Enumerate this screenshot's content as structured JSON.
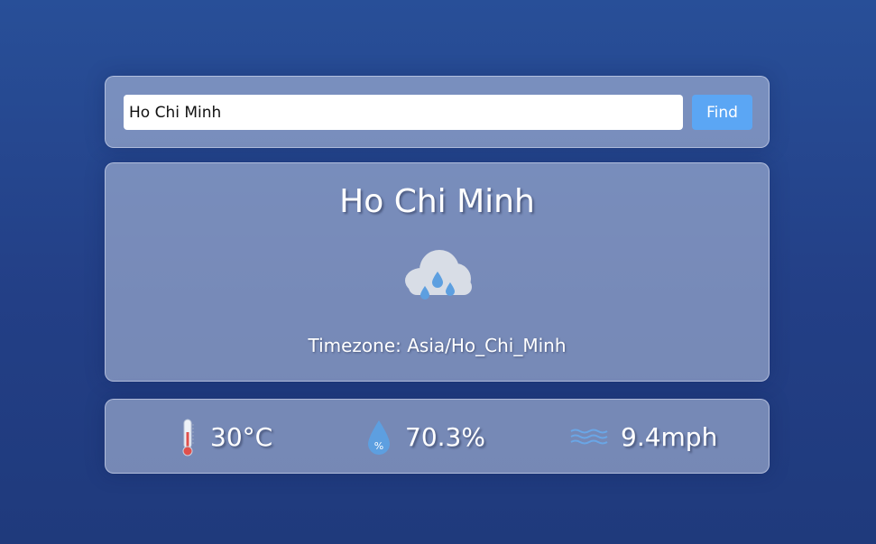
{
  "search": {
    "value": "Ho Chi Minh",
    "button_label": "Find"
  },
  "weather": {
    "city": "Ho Chi Minh",
    "condition_icon": "rain-cloud-icon",
    "timezone_label": "Timezone: Asia/Ho_Chi_Minh"
  },
  "stats": {
    "temperature": {
      "icon": "thermometer-icon",
      "value": "30°C"
    },
    "humidity": {
      "icon": "humidity-drop-icon",
      "value": "70.3%"
    },
    "wind": {
      "icon": "wind-icon",
      "value": "9.4mph"
    }
  },
  "colors": {
    "background": "#264a92",
    "find_button": "#5ba6f4",
    "rain_drop": "#5d9fe0",
    "cloud": "#d8dde6"
  }
}
